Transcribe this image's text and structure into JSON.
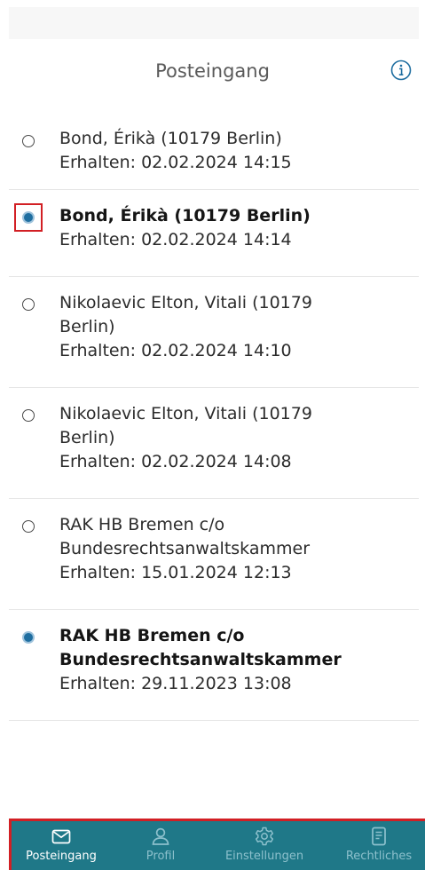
{
  "header": {
    "title": "Posteingang",
    "info_icon": "info-circle-icon"
  },
  "messages": [
    {
      "sender": "Bond, Érikà (10179 Berlin)",
      "received": "Erhalten: 02.02.2024 14:15",
      "unread": false,
      "highlighted": false
    },
    {
      "sender": "Bond, Érikà (10179 Berlin)",
      "received": "Erhalten: 02.02.2024 14:14",
      "unread": true,
      "highlighted": true
    },
    {
      "sender_line1": "Nikolaevic Elton, Vitali (10179",
      "sender_line2": "Berlin)",
      "received": "Erhalten: 02.02.2024 14:10",
      "unread": false,
      "highlighted": false
    },
    {
      "sender_line1": "Nikolaevic Elton, Vitali (10179",
      "sender_line2": "Berlin)",
      "received": "Erhalten: 02.02.2024 14:08",
      "unread": false,
      "highlighted": false
    },
    {
      "sender_line1": "RAK HB Bremen c/o",
      "sender_line2": "Bundesrechtsanwaltskammer",
      "received": "Erhalten: 15.01.2024 12:13",
      "unread": false,
      "highlighted": false
    },
    {
      "sender_line1": "RAK HB Bremen c/o",
      "sender_line2": "Bundesrechtsanwaltskammer",
      "received": "Erhalten: 29.11.2023 13:08",
      "unread": true,
      "highlighted": false
    }
  ],
  "tabbar": {
    "tabs": [
      {
        "label": "Posteingang",
        "icon": "mail-icon",
        "active": true
      },
      {
        "label": "Profil",
        "icon": "person-icon",
        "active": false
      },
      {
        "label": "Einstellungen",
        "icon": "gear-icon",
        "active": false
      },
      {
        "label": "Rechtliches",
        "icon": "document-icon",
        "active": false
      }
    ]
  },
  "colors": {
    "accent": "#1f7888",
    "unread_dot": "#1f6ea0",
    "highlight": "#d21f24",
    "inactive_tab": "#8cc0cc"
  }
}
